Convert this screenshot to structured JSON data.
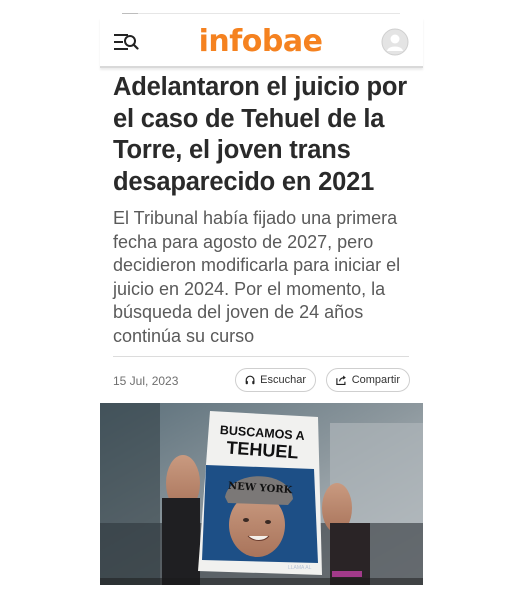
{
  "header": {
    "logo_text": "infobae",
    "menu_icon": "menu-search-icon",
    "account_icon": "user-avatar-icon",
    "brand_color": "#f58220"
  },
  "article": {
    "title": "Adelantaron el juicio por el caso de Tehuel de la Torre, el joven trans desaparecido en 2021",
    "lead": "El Tribunal había fijado una primera fecha para agosto de 2027, pero decidieron modificarla para iniciar el juicio en 2024. Por el momento, la búsqueda del joven de 24 años continúa su curso",
    "date": "15 Jul, 2023",
    "listen_label": "Escuchar",
    "share_label": "Compartir"
  },
  "photo": {
    "sign_line1": "BUSCAMOS A",
    "sign_line2": "TEHUEL",
    "cap_text": "NEW YORK",
    "sign_footer": "LLAMA AL"
  }
}
